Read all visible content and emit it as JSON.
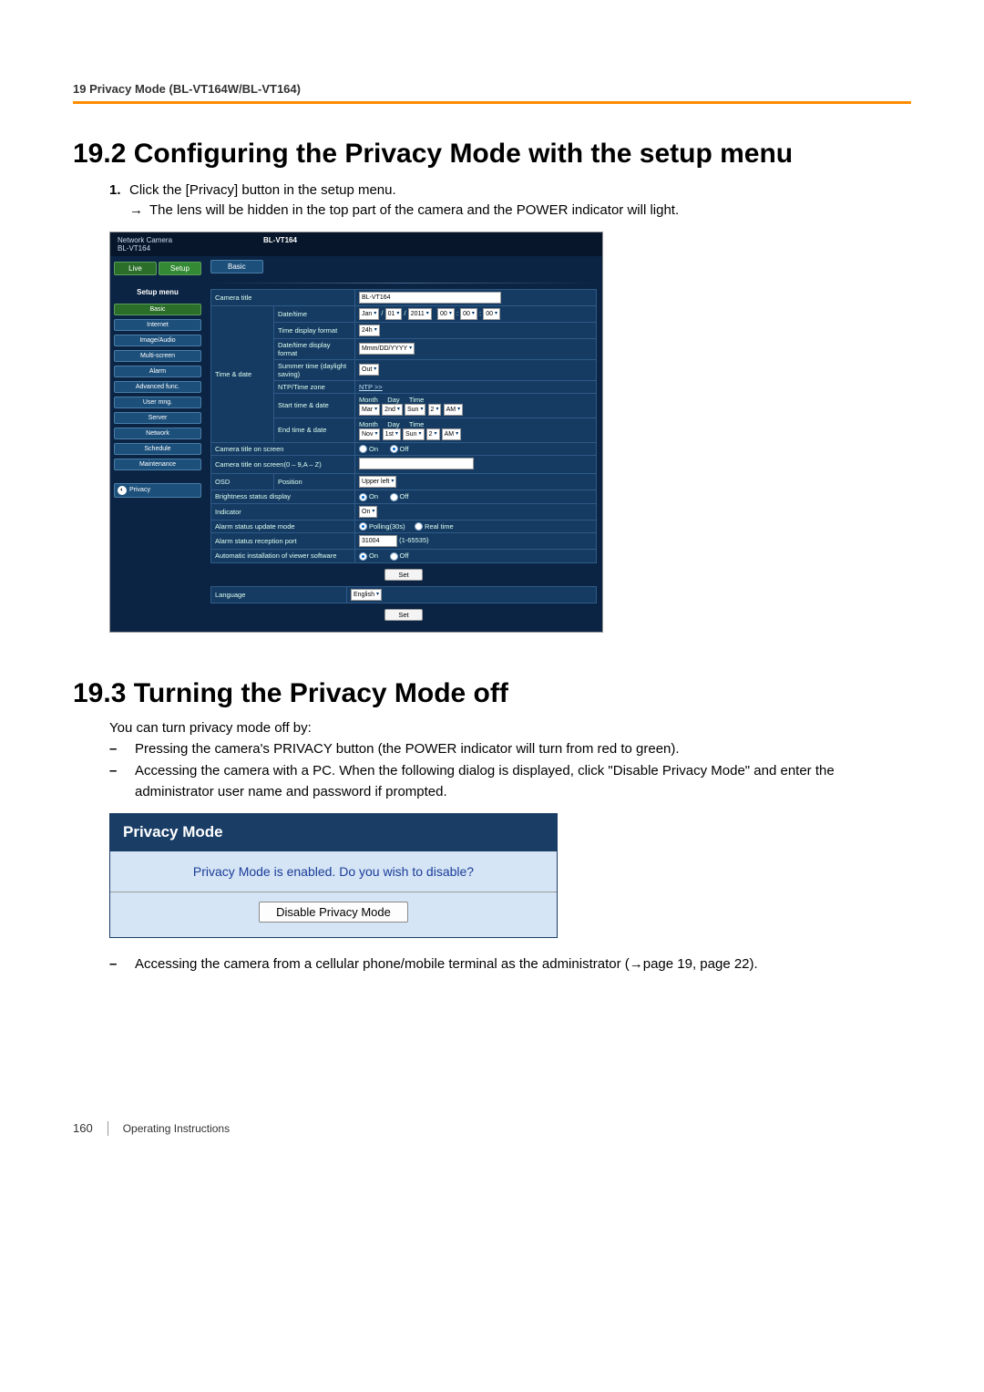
{
  "header": {
    "breadcrumb": "19 Privacy Mode (BL-VT164W/BL-VT164)"
  },
  "section192": {
    "title": "19.2  Configuring the Privacy Mode with the setup menu",
    "step1_num": "1.",
    "step1_text": "Click the [Privacy] button in the setup menu.",
    "step1_arrow": "→",
    "step1_sub": "The lens will be hidden in the top part of the camera and the POWER indicator will light."
  },
  "camshot": {
    "top_left": "Network Camera\nBL-VT164",
    "top_model": "BL-VT164",
    "tab_live": "Live",
    "tab_setup": "Setup",
    "side_title": "Setup menu",
    "nav": {
      "basic": "Basic",
      "internet": "Internet",
      "image_audio": "Image/Audio",
      "multi_screen": "Multi-screen",
      "alarm": "Alarm",
      "advanced": "Advanced func.",
      "user_mng": "User mng.",
      "server": "Server",
      "network": "Network",
      "schedule": "Schedule",
      "maintenance": "Maintenance",
      "privacy": "Privacy"
    },
    "main_tab": "Basic",
    "rows": {
      "camera_title": "Camera title",
      "camera_title_value": "BL-VT164",
      "time_date": "Time & date",
      "datetime": "Date/time",
      "datetime_vals": {
        "mon": "Jan",
        "day": "01",
        "year": "2011",
        "h": "00",
        "m": "00",
        "s": "00",
        "slash": "/",
        "colon": ":"
      },
      "time_display_format": "Time display format",
      "time_display_val": "24h",
      "datetime_display_format": "Date/time display format",
      "datetime_display_val": "Mmm/DD/YYYY",
      "summer_time": "Summer time (daylight saving)",
      "summer_time_val": "Out",
      "ntp_time_zone": "NTP/Time zone",
      "ntp_link": "NTP >>",
      "start_time": "Start time & date",
      "end_time": "End time & date",
      "mdt_month": "Month",
      "mdt_day": "Day",
      "mdt_time": "Time",
      "mdt_mar": "Mar",
      "mdt_2nd": "2nd",
      "mdt_sun": "Sun",
      "mdt_2": "2",
      "mdt_am": "AM",
      "mdt_nov": "Nov",
      "mdt_1st": "1st",
      "camera_title_on_screen": "Camera title on screen",
      "on": "On",
      "off": "Off",
      "camera_title_chars": "Camera title on screen(0 – 9,A – Z)",
      "osd": "OSD",
      "position": "Position",
      "position_val": "Upper left",
      "brightness_status": "Brightness status display",
      "indicator": "Indicator",
      "indicator_val": "On",
      "alarm_status_update": "Alarm status update mode",
      "polling": "Polling(30s)",
      "realtime": "Real time",
      "alarm_reception_port": "Alarm status reception port",
      "port_val": "31004",
      "port_range": "(1-65535)",
      "auto_install_viewer": "Automatic installation of viewer software",
      "set": "Set",
      "language": "Language",
      "language_val": "English"
    }
  },
  "section193": {
    "title": "19.3  Turning the Privacy Mode off",
    "intro": "You can turn privacy mode off by:",
    "b1": "Pressing the camera's PRIVACY button (the POWER indicator will turn from red to green).",
    "b2": "Accessing the camera with a PC. When the following dialog is displayed, click \"Disable Privacy Mode\" and enter the administrator user name and password if prompted.",
    "b3": "Accessing the camera from a cellular phone/mobile terminal as the administrator (→page 19, page 22)."
  },
  "dialog": {
    "title": "Privacy Mode",
    "message": "Privacy Mode is enabled. Do you wish to disable?",
    "button": "Disable Privacy Mode"
  },
  "footer": {
    "page": "160",
    "label": "Operating Instructions"
  }
}
